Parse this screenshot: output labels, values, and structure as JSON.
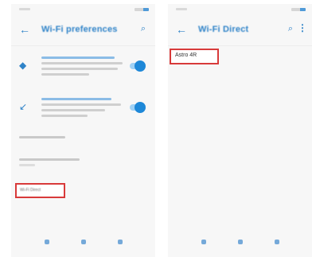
{
  "left_screen": {
    "app_bar": {
      "back_icon": "arrow-back-icon",
      "title": "Wi-Fi preferences",
      "search_icon": "search-icon"
    },
    "settings": [
      {
        "icon": "wifi-icon",
        "toggle_on": true
      },
      {
        "icon": "network-icon",
        "toggle_on": true
      }
    ],
    "highlighted_item": "Wi-Fi Direct"
  },
  "right_screen": {
    "app_bar": {
      "back_icon": "arrow-back-icon",
      "title": "Wi-Fi Direct",
      "search_icon": "search-icon",
      "more_icon": "more-vert-icon"
    },
    "device": {
      "name": "Astro 4R"
    }
  },
  "colors": {
    "accent": "#2f83c8",
    "highlight": "#d83a3a",
    "toggle": "#1e88d8"
  }
}
